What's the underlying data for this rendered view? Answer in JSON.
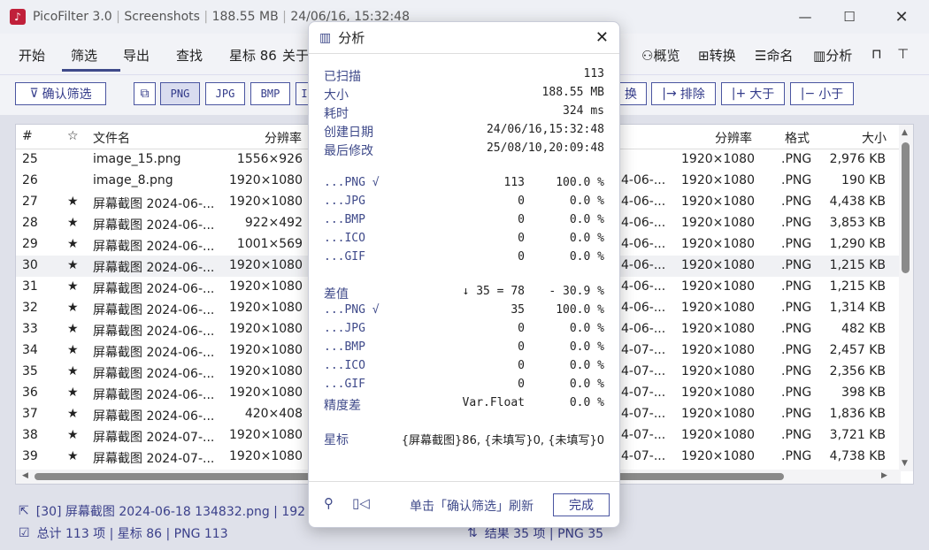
{
  "window": {
    "app": "PicoFilter 3.0",
    "folder": "Screenshots",
    "size": "188.55 MB",
    "time": "24/06/16, 15:32:48"
  },
  "menu": {
    "items": [
      "开始",
      "筛选",
      "导出",
      "查找",
      "星标 86",
      "关于"
    ],
    "right": [
      "概览",
      "转换",
      "命名",
      "分析"
    ]
  },
  "toolbar": {
    "confirm_filter": "确认筛选",
    "formats": [
      "PNG",
      "JPG",
      "BMP",
      "I"
    ],
    "right": [
      "换",
      "排除",
      "大于",
      "小于"
    ]
  },
  "table_left": {
    "headers": [
      "#",
      "☆",
      "文件名",
      "分辨率"
    ],
    "rows": [
      {
        "n": "25",
        "star": "",
        "name": "image_15.png",
        "res": "1556×926"
      },
      {
        "n": "26",
        "star": "",
        "name": "image_8.png",
        "res": "1920×1080"
      },
      {
        "n": "27",
        "star": "★",
        "name": "屏幕截图 2024-06-...",
        "res": "1920×1080"
      },
      {
        "n": "28",
        "star": "★",
        "name": "屏幕截图 2024-06-...",
        "res": "922×492"
      },
      {
        "n": "29",
        "star": "★",
        "name": "屏幕截图 2024-06-...",
        "res": "1001×569"
      },
      {
        "n": "30",
        "star": "★",
        "name": "屏幕截图 2024-06-...",
        "res": "1920×1080"
      },
      {
        "n": "31",
        "star": "★",
        "name": "屏幕截图 2024-06-...",
        "res": "1920×1080"
      },
      {
        "n": "32",
        "star": "★",
        "name": "屏幕截图 2024-06-...",
        "res": "1920×1080"
      },
      {
        "n": "33",
        "star": "★",
        "name": "屏幕截图 2024-06-...",
        "res": "1920×1080"
      },
      {
        "n": "34",
        "star": "★",
        "name": "屏幕截图 2024-06-...",
        "res": "1920×1080"
      },
      {
        "n": "35",
        "star": "★",
        "name": "屏幕截图 2024-06-...",
        "res": "1920×1080"
      },
      {
        "n": "36",
        "star": "★",
        "name": "屏幕截图 2024-06-...",
        "res": "1920×1080"
      },
      {
        "n": "37",
        "star": "★",
        "name": "屏幕截图 2024-06-...",
        "res": "420×408"
      },
      {
        "n": "38",
        "star": "★",
        "name": "屏幕截图 2024-07-...",
        "res": "1920×1080"
      },
      {
        "n": "39",
        "star": "★",
        "name": "屏幕截图 2024-07-...",
        "res": "1920×1080"
      }
    ]
  },
  "table_right": {
    "headers": [
      "分辨率",
      "格式",
      "大小"
    ],
    "rows": [
      {
        "name": "",
        "res": "1920×1080",
        "fmt": ".PNG",
        "size": "2,976 KB"
      },
      {
        "name": "4-06-...",
        "res": "1920×1080",
        "fmt": ".PNG",
        "size": "190 KB"
      },
      {
        "name": "4-06-...",
        "res": "1920×1080",
        "fmt": ".PNG",
        "size": "4,438 KB"
      },
      {
        "name": "4-06-...",
        "res": "1920×1080",
        "fmt": ".PNG",
        "size": "3,853 KB"
      },
      {
        "name": "4-06-...",
        "res": "1920×1080",
        "fmt": ".PNG",
        "size": "1,290 KB"
      },
      {
        "name": "4-06-...",
        "res": "1920×1080",
        "fmt": ".PNG",
        "size": "1,215 KB"
      },
      {
        "name": "4-06-...",
        "res": "1920×1080",
        "fmt": ".PNG",
        "size": "1,215 KB"
      },
      {
        "name": "4-06-...",
        "res": "1920×1080",
        "fmt": ".PNG",
        "size": "1,314 KB"
      },
      {
        "name": "4-06-...",
        "res": "1920×1080",
        "fmt": ".PNG",
        "size": "482 KB"
      },
      {
        "name": "4-07-...",
        "res": "1920×1080",
        "fmt": ".PNG",
        "size": "2,457 KB"
      },
      {
        "name": "4-07-...",
        "res": "1920×1080",
        "fmt": ".PNG",
        "size": "2,356 KB"
      },
      {
        "name": "4-07-...",
        "res": "1920×1080",
        "fmt": ".PNG",
        "size": "398 KB"
      },
      {
        "name": "4-07-...",
        "res": "1920×1080",
        "fmt": ".PNG",
        "size": "1,836 KB"
      },
      {
        "name": "4-07-...",
        "res": "1920×1080",
        "fmt": ".PNG",
        "size": "3,721 KB"
      },
      {
        "name": "4-07-...",
        "res": "1920×1080",
        "fmt": ".PNG",
        "size": "4,738 KB"
      }
    ]
  },
  "status": {
    "selected": "[30] 屏幕截图 2024-06-18 134832.png  |  192",
    "totals": "总计 113 项  |  星标 86  |  PNG 113",
    "results": "结果 35 项  |  PNG 35"
  },
  "dialog": {
    "title": "分析",
    "info": [
      {
        "label": "已扫描",
        "value": "113"
      },
      {
        "label": "大小",
        "value": "188.55 MB"
      },
      {
        "label": "耗时",
        "value": "324 ms"
      },
      {
        "label": "创建日期",
        "value": "24/06/16,15:32:48"
      },
      {
        "label": "最后修改",
        "value": "25/08/10,20:09:48"
      }
    ],
    "formats1": [
      {
        "label": "...PNG √",
        "count": "113",
        "pct": "100.0 %"
      },
      {
        "label": "...JPG",
        "count": "0",
        "pct": "0.0 %"
      },
      {
        "label": "...BMP",
        "count": "0",
        "pct": "0.0 %"
      },
      {
        "label": "...ICO",
        "count": "0",
        "pct": "0.0 %"
      },
      {
        "label": "...GIF",
        "count": "0",
        "pct": "0.0 %"
      }
    ],
    "diff": {
      "label": "差值",
      "count": "↓ 35 = 78",
      "pct": "- 30.9 %"
    },
    "formats2": [
      {
        "label": "...PNG √",
        "count": "35",
        "pct": "100.0 %"
      },
      {
        "label": "...JPG",
        "count": "0",
        "pct": "0.0 %"
      },
      {
        "label": "...BMP",
        "count": "0",
        "pct": "0.0 %"
      },
      {
        "label": "...ICO",
        "count": "0",
        "pct": "0.0 %"
      },
      {
        "label": "...GIF",
        "count": "0",
        "pct": "0.0 %"
      }
    ],
    "precision": {
      "label": "精度差",
      "count": "Var.Float",
      "pct": "0.0 %"
    },
    "star": {
      "label": "星标",
      "value": "{屏幕截图}86, {未填写}0, {未填写}0"
    },
    "hint": "单击「确认筛选」刷新",
    "done": "完成"
  },
  "colors": {
    "accent": "#3f4a8a",
    "brand": "#c0203a"
  }
}
